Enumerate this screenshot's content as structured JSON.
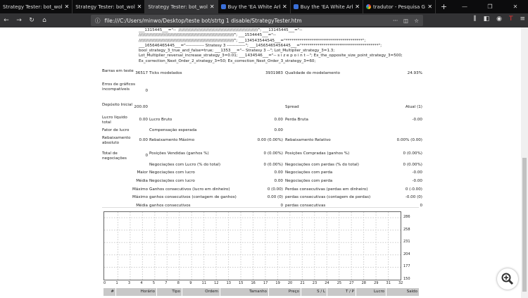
{
  "browser": {
    "tabs": [
      {
        "title": "Strategy Tester: bot_wolfzeac",
        "active": false,
        "icon": "none"
      },
      {
        "title": "Strategy Tester: bot_wolfzeac",
        "active": false,
        "icon": "none"
      },
      {
        "title": "Strategy Tester: bot_wolfzeac",
        "active": true,
        "icon": "none"
      },
      {
        "title": "Buy the 'EA White Arbitra",
        "active": false,
        "icon": "mql5-icon"
      },
      {
        "title": "Buy the 'EA White Arbitra",
        "active": false,
        "icon": "mql5-icon"
      },
      {
        "title": "tradutor - Pesquisa Goog",
        "active": false,
        "icon": "google-icon"
      }
    ],
    "url": "file:///C:/Users/minwo/Desktop/teste bot/strtg 1 disable/StrategyTester.htm"
  },
  "params_text": "___1315445___=\"--  ////////////////////////////////////////////////////////////\"; ___13145445___=\"--\n////////////////////////////////////////////////////////////////////////\"; ___1534445___=\"--\n////////////////////////////////////////////////////////////////////////\"; ___134543544545___=\"***************************************\";\n___165646465445___=\"------------- Stratesy 3 -------------\"; ___14565465456445___=\"***************************************\";\nbool_strategy_3_true_and_false=true; ___1353___=\"-- Stratesy 3 --\"; Lot_Multiplier_strategy_3=1.3;\nLot_Multiplier_reversal_increase_strategy_3=0.01; ___1434546___=\"-- s i z e p o i n t --\"; Ex_the_opposite_size_point_strategy_3=500;\nEx_correction_Next_Order_2_strategy_3=50; Ex_correction_Next_Order_3_strategy_3=60;",
  "stats": {
    "bars_label": "Barras em teste",
    "bars": "36517",
    "ticks_label": "Ticks modelados",
    "ticks": "3931983",
    "quality_label": "Qualidade do modelamento",
    "quality": "24.93%",
    "errors_label": "Erros de gráficos incompatíveis",
    "errors": "0",
    "deposit_label": "Depósito Inicial",
    "deposit": "200.00",
    "spread_label": "Spread",
    "spread": "Atual (1)",
    "net_label": "Lucro líquido total",
    "net": "0.00",
    "gross_profit_label": "Lucro Bruto",
    "gross_profit": "0.00",
    "gross_loss_label": "Perda Bruta",
    "gross_loss": "-0.00",
    "pf_label": "Fator de lucro",
    "expected_label": "Compensação esperada",
    "expected": "0.00",
    "abs_dd_label": "Rebaixamento absoluto",
    "abs_dd": "0.00",
    "max_dd_label": "Rebaixamento Máximo",
    "max_dd": "0.00 (0.00%)",
    "rel_dd_label": "Rebaixamento Relativo",
    "rel_dd": "0.00% (0.00)",
    "total_label": "Total de negociações",
    "total": "0",
    "rows": [
      {
        "rl": "",
        "l2": "Posições Vendidas (ganhos %)",
        "v2": "0 (0.00%)",
        "l3": "Posições Compradas (ganhos %)",
        "v3": "0 (0.00%)"
      },
      {
        "rl": "",
        "l2": "Negociações com Lucro (% do total)",
        "v2": "0 (0.00%)",
        "l3": "Negociações com perdas (% do total)",
        "v3": "0 (0.00%)"
      },
      {
        "rl": "Maior",
        "l2": "Negociações com lucro",
        "v2": "0.00",
        "l3": "Negociações com perda",
        "v3": "-0.00"
      },
      {
        "rl": "Média",
        "l2": "Negociações com lucro",
        "v2": "0.00",
        "l3": "Negociações com perda",
        "v3": "-0.00"
      },
      {
        "rl": "Máximo",
        "l2": "Ganhos consecutivos (lucro em dinheiro)",
        "v2": "0 (0.00)",
        "l3": "Perdas consecutivas (perdas em dinheiro)",
        "v3": "0 (-0.00)"
      },
      {
        "rl": "Máximo",
        "l2": "ganhos consecutivos (contagem de ganhos)",
        "v2": "0.00 (0)",
        "l3": "perdas consecutivas (contagem de perdas)",
        "v3": "-0.00 (0)"
      },
      {
        "rl": "Média",
        "l2": "ganhos consecutivos",
        "v2": "0",
        "l3": "perdas consecutivas",
        "v3": "0"
      }
    ]
  },
  "chart": {
    "y_ticks": [
      "286",
      "258",
      "231",
      "204",
      "177",
      "150"
    ],
    "x_ticks": [
      "0",
      "1",
      "3",
      "4",
      "5",
      "7",
      "8",
      "9",
      "11",
      "12",
      "13",
      "15",
      "16",
      "17",
      "19",
      "20",
      "21",
      "23",
      "24",
      "25",
      "27",
      "28",
      "29",
      "31",
      "32"
    ]
  },
  "table_headers": [
    "#",
    "Horário",
    "Tipo",
    "Ordem",
    "Tamanho",
    "Preço",
    "S / L",
    "T / P",
    "Lucro",
    "Saldo"
  ]
}
